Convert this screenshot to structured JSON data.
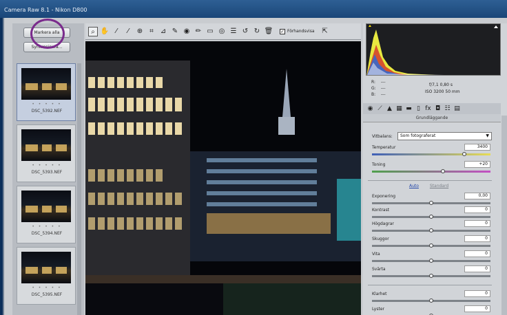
{
  "window": {
    "title": "Camera Raw 8.1  -  Nikon D800"
  },
  "filmstrip": {
    "select_all_label": "Markera alla",
    "synchronize_label": "Synkronisera...",
    "thumbnails": [
      {
        "name": "DSC_5392.NEF",
        "stars": "• • • • •",
        "selected": true
      },
      {
        "name": "DSC_5393.NEF",
        "stars": "• • • • •",
        "selected": false
      },
      {
        "name": "DSC_5394.NEF",
        "stars": "• • • • •",
        "selected": false
      },
      {
        "name": "DSC_5395.NEF",
        "stars": "• • • • •",
        "selected": false
      }
    ]
  },
  "toolbar": {
    "tools": [
      "zoom",
      "hand",
      "white-balance",
      "color-sampler",
      "target-adjust",
      "crop",
      "straighten",
      "spot-removal",
      "red-eye",
      "adjustment-brush",
      "graduated-filter",
      "radial-filter",
      "presets",
      "rotate-ccw",
      "rotate-cw",
      "trash"
    ],
    "preview_label": "Förhandsvisa",
    "preview_checked": true
  },
  "info": {
    "r_label": "R:",
    "g_label": "G:",
    "b_label": "B:",
    "dash": "---",
    "aperture_shutter": "f/7,1  0,80 s",
    "iso_lens": "ISO 3200   50 mm"
  },
  "panel": {
    "section_title": "Grundläggande",
    "white_balance": {
      "label": "Vitbalans:",
      "value": "Som fotograferat"
    },
    "auto_label": "Auto",
    "default_label": "Standard",
    "sliders": [
      {
        "key": "temperature",
        "label": "Temperatur",
        "value": "3400",
        "pos": 0.78
      },
      {
        "key": "tint",
        "label": "Toning",
        "value": "+20",
        "pos": 0.6
      },
      {
        "key": "exposure",
        "label": "Exponering",
        "value": "0,00",
        "pos": 0.5
      },
      {
        "key": "contrast",
        "label": "Kontrast",
        "value": "0",
        "pos": 0.5
      },
      {
        "key": "highlights",
        "label": "Högdagrar",
        "value": "0",
        "pos": 0.5
      },
      {
        "key": "shadows",
        "label": "Skuggor",
        "value": "0",
        "pos": 0.5
      },
      {
        "key": "whites",
        "label": "Vita",
        "value": "0",
        "pos": 0.5
      },
      {
        "key": "blacks",
        "label": "Svärta",
        "value": "0",
        "pos": 0.5
      },
      {
        "key": "clarity",
        "label": "Klarhet",
        "value": "0",
        "pos": 0.5
      },
      {
        "key": "vibrance",
        "label": "Lyster",
        "value": "0",
        "pos": 0.5
      }
    ]
  },
  "colors": {
    "annotation_circle": "#7a2b8c",
    "link": "#2246a8"
  }
}
